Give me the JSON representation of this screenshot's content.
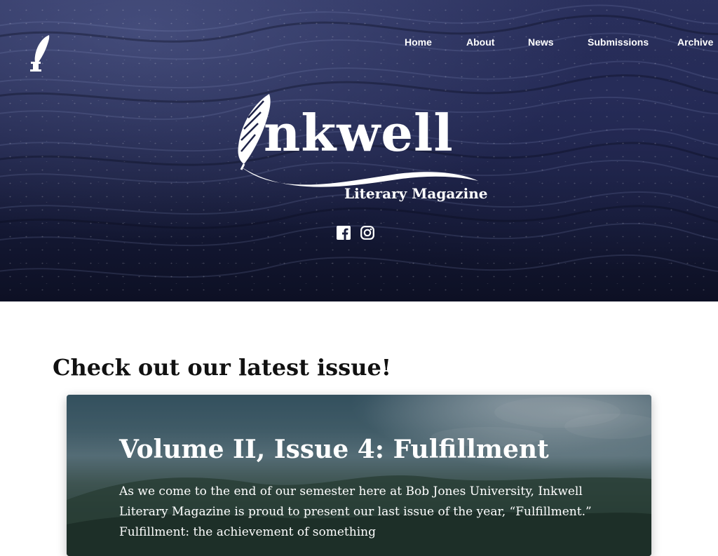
{
  "nav": {
    "items": [
      {
        "label": "Home"
      },
      {
        "label": "About"
      },
      {
        "label": "News"
      },
      {
        "label": "Submissions"
      },
      {
        "label": "Archive"
      }
    ]
  },
  "hero": {
    "wordmark": "nkwell",
    "subtitle": "Literary Magazine",
    "social": [
      "facebook-icon",
      "instagram-icon"
    ]
  },
  "latest": {
    "heading": "Check out our latest issue!",
    "issue": {
      "title": "Volume II, Issue 4: Fulfillment",
      "description": "As we come to the end of our semester here at Bob Jones University, Inkwell Literary Magazine is proud to present our last issue of the year, “Fulfillment.” Fulfillment: the achievement of something"
    }
  },
  "colors": {
    "hero_dark": "#1d2247",
    "text_dark": "#111111",
    "white": "#ffffff"
  }
}
